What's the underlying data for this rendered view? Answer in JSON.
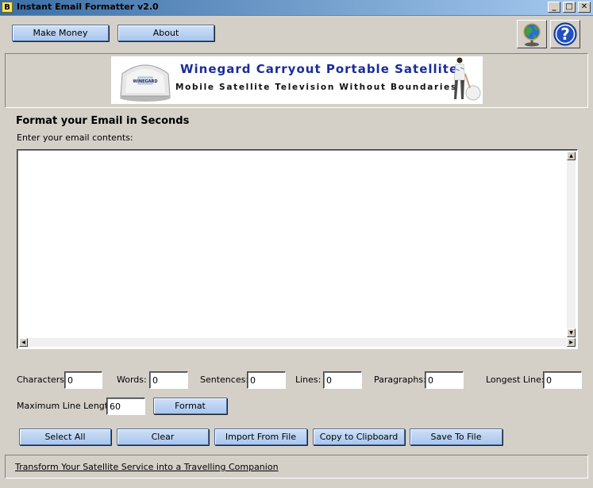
{
  "window": {
    "app_icon": "B",
    "title": "Instant Email Formatter v2.0",
    "minimize_glyph": "_",
    "maximize_glyph": "□",
    "close_glyph": "✕"
  },
  "toolbar": {
    "make_money_label": "Make Money",
    "about_label": "About",
    "globe_icon": "globe-icon",
    "help_icon": "help-icon",
    "help_glyph": "?"
  },
  "banner": {
    "title": "Winegard Carryout Portable Satellite",
    "subtitle": "Mobile Satellite Television Without Boundaries",
    "dish_text": "WINEGARD",
    "title_color": "#1a2c9a"
  },
  "main": {
    "heading": "Format your Email in Seconds",
    "prompt": "Enter your email contents:",
    "email_contents": ""
  },
  "stats": {
    "characters_label": "Characters:",
    "characters_value": "0",
    "words_label": "Words:",
    "words_value": "0",
    "sentences_label": "Sentences:",
    "sentences_value": "0",
    "lines_label": "Lines:",
    "lines_value": "0",
    "paragraphs_label": "Paragraphs:",
    "paragraphs_value": "0",
    "longest_line_label": "Longest Line:",
    "longest_line_value": "0"
  },
  "format": {
    "max_line_length_label": "Maximum Line Length:",
    "max_line_length_value": "60",
    "format_label": "Format"
  },
  "actions": {
    "select_all_label": "Select All",
    "clear_label": "Clear",
    "import_label": "Import From File",
    "copy_label": "Copy to Clipboard",
    "save_label": "Save To File"
  },
  "footer": {
    "link_text": "Transform Your Satellite Service into a Travelling Companion"
  }
}
